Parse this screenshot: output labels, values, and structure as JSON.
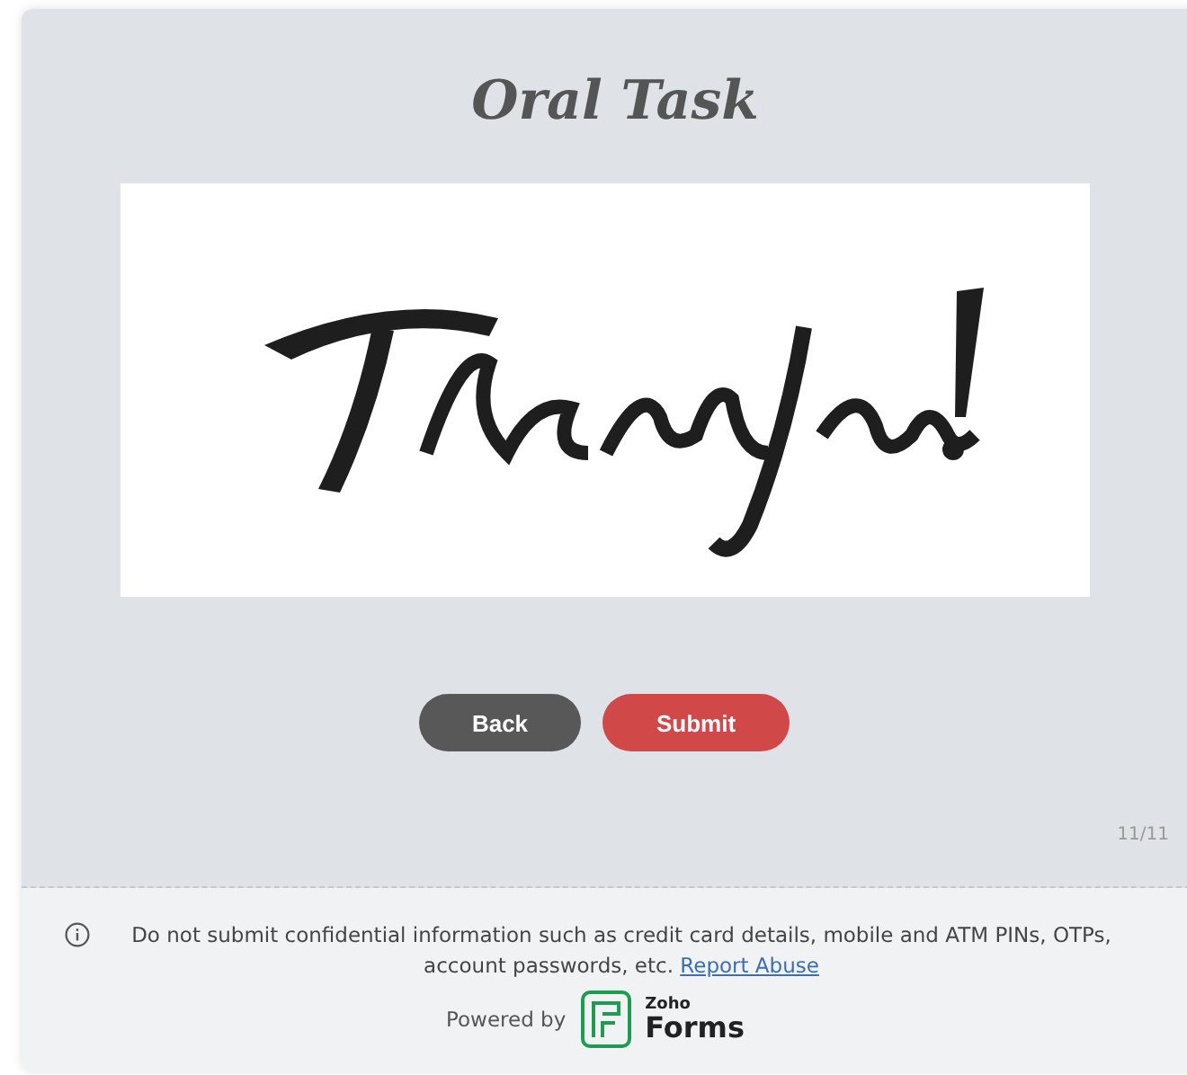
{
  "form": {
    "title": "Oral Task",
    "buttons": [
      {
        "label": "Back",
        "kind": "back"
      },
      {
        "label": "Submit",
        "kind": "submit"
      }
    ],
    "page_indicator": "11/11"
  },
  "footer": {
    "notice": "Do not submit confidential information such as credit card details, mobile and ATM PINs, OTPs, account passwords, etc.",
    "report_link": "Report Abuse",
    "powered_by": "Powered by",
    "brand_small": "Zoho",
    "brand_large": "Forms"
  }
}
